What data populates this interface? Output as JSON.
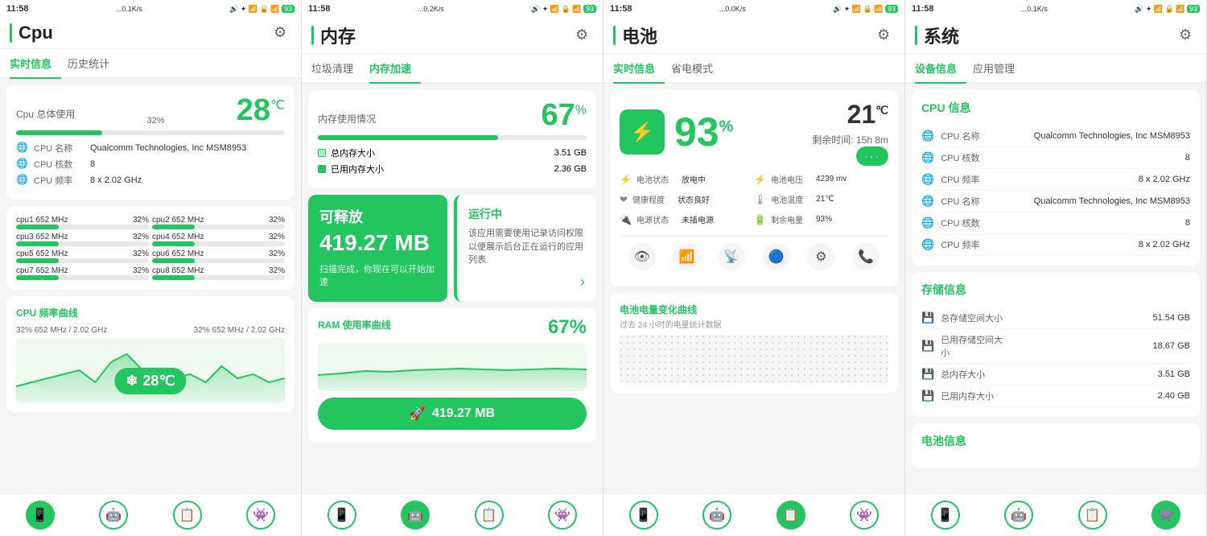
{
  "panels": [
    {
      "id": "cpu",
      "status_bar": {
        "time": "11:58",
        "signal": "...0.1K/s",
        "icons": "🔊 📶 🔒 📶 93"
      },
      "title": "Cpu",
      "tabs": [
        "实时信息",
        "历史统计"
      ],
      "active_tab": 0,
      "usage_label": "Cpu 总体使用",
      "usage_pct": "32%",
      "temp": "28",
      "temp_unit": "℃",
      "cpu_info": [
        {
          "label": "CPU 名称",
          "value": "Qualcomm Technologies, Inc MSM8953"
        },
        {
          "label": "CPU 核数",
          "value": "8"
        },
        {
          "label": "CPU 频率",
          "value": "8 x 2.02 GHz"
        }
      ],
      "cores": [
        {
          "name": "cpu1",
          "freq": "652 MHz",
          "pct": "32%",
          "bar": 32
        },
        {
          "name": "cpu2",
          "freq": "652 MHz",
          "pct": "32%",
          "bar": 32
        },
        {
          "name": "cpu3",
          "freq": "652 MHz",
          "pct": "32%",
          "bar": 32
        },
        {
          "name": "cpu4",
          "freq": "652 MHz",
          "pct": "32%",
          "bar": 32
        },
        {
          "name": "cpu5",
          "freq": "652 MHz",
          "pct": "32%",
          "bar": 32
        },
        {
          "name": "cpu6",
          "freq": "652 MHz",
          "pct": "32%",
          "bar": 32
        },
        {
          "name": "cpu7",
          "freq": "652 MHz",
          "pct": "32%",
          "bar": 32
        },
        {
          "name": "cpu8",
          "freq": "652 MHz",
          "pct": "32%",
          "bar": 32
        }
      ],
      "chart_title": "CPU 频率曲线",
      "chart_labels": [
        "32%  652 MHz / 2.02 GHz",
        "32%  652 MHz / 2.02 GHz"
      ],
      "temp_badge": "28℃",
      "nav_icons": [
        "📱",
        "🤖",
        "📋",
        "👾"
      ]
    },
    {
      "id": "memory",
      "status_bar": {
        "time": "11:58",
        "signal": "...0.2K/s"
      },
      "title": "内存",
      "tabs": [
        "垃圾清理",
        "内存加速"
      ],
      "active_tab": 1,
      "usage_label": "内存使用情况",
      "usage_pct": "67",
      "total_mem": "3.51 GB",
      "used_mem": "2.36 GB",
      "total_label": "总内存大小",
      "used_label": "已用内存大小",
      "accel_title": "可释放",
      "accel_size": "419.27 MB",
      "accel_desc": "扫描完成，你现在可以开始加速",
      "running_title": "运行中",
      "running_desc": "该应用需要使用记录访问权限以便展示后台正在运行的应用列表",
      "ram_title": "RAM 使用率曲线",
      "ram_pct": "67%",
      "accel_btn": "419.27 MB",
      "nav_icons": [
        "📱",
        "🤖",
        "📋",
        "👾"
      ]
    },
    {
      "id": "battery",
      "status_bar": {
        "time": "11:58",
        "signal": "...0.0K/s"
      },
      "title": "电池",
      "tabs": [
        "实时信息",
        "省电模式"
      ],
      "active_tab": 0,
      "battery_pct": "93",
      "battery_temp": "21",
      "temp_unit": "℃",
      "remain_label": "剩余时间:",
      "remain_time": "15h 8m",
      "more_btn": "···",
      "bat_status_items": [
        {
          "label": "电池状态",
          "value": "放电中"
        },
        {
          "label": "电池电压",
          "value": "4239 mv"
        },
        {
          "label": "健康程度",
          "value": "状态良好"
        },
        {
          "label": "电池温度",
          "value": "21℃"
        },
        {
          "label": "电源状态",
          "value": "未插电源"
        },
        {
          "label": "剩余电量",
          "value": "93%"
        }
      ],
      "icons_row": [
        "👁",
        "📶",
        "📡",
        "🔵",
        "⚙",
        "📞"
      ],
      "curve_title": "电池电量变化曲线",
      "curve_sub": "过去 24 小时的电量统计数据",
      "nav_icons": [
        "📱",
        "🤖",
        "📋",
        "👾"
      ]
    },
    {
      "id": "system",
      "status_bar": {
        "time": "11:58",
        "signal": "...0.1K/s"
      },
      "title": "系统",
      "tabs": [
        "设备信息",
        "应用管理"
      ],
      "active_tab": 0,
      "cpu_section_title": "CPU 信息",
      "cpu_rows": [
        {
          "label": "CPU 名称",
          "value": "Qualcomm Technologies, Inc MSM8953"
        },
        {
          "label": "CPU 核数",
          "value": "8"
        },
        {
          "label": "CPU 频率",
          "value": "8 x 2.02 GHz"
        },
        {
          "label": "CPU 名称",
          "value": "Qualcomm Technologies, Inc MSM8953"
        },
        {
          "label": "CPU 核数",
          "value": "8"
        },
        {
          "label": "CPU 频率",
          "value": "8 x 2.02 GHz"
        }
      ],
      "storage_section_title": "存储信息",
      "storage_rows": [
        {
          "label": "总存储空间大小",
          "value": "51.54 GB"
        },
        {
          "label": "已用存储空间大小",
          "value": "18.67 GB"
        },
        {
          "label": "总内存大小",
          "value": "3.51 GB"
        },
        {
          "label": "已用内存大小",
          "value": "2.40 GB"
        }
      ],
      "battery_section_title": "电池信息",
      "nav_icons": [
        "📱",
        "🤖",
        "📋",
        "👾"
      ]
    }
  ]
}
